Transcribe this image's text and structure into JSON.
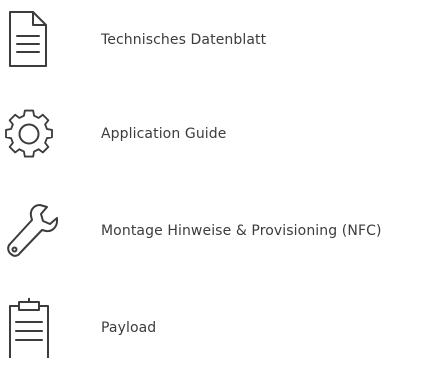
{
  "documents": [
    {
      "label": "Technisches Datenblatt",
      "icon": "document-icon"
    },
    {
      "label": "Application Guide",
      "icon": "gear-icon"
    },
    {
      "label": "Montage Hinweise & Provisioning (NFC)",
      "icon": "wrench-icon"
    },
    {
      "label": "Payload",
      "icon": "clipboard-icon"
    }
  ],
  "colors": {
    "text": "#3c3c3c",
    "icon_stroke": "#3c3c3c",
    "background": "#ffffff"
  }
}
